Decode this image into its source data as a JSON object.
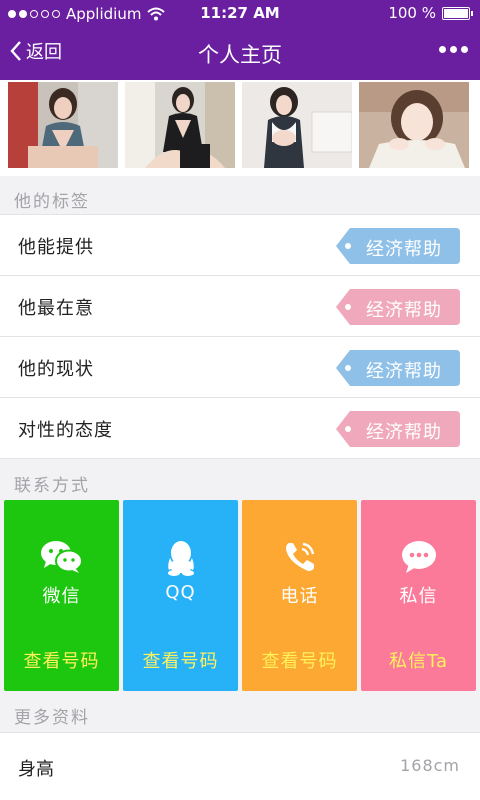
{
  "status_bar": {
    "carrier": "Applidium",
    "time": "11:27 AM",
    "battery": "100 %"
  },
  "nav": {
    "back_label": "返回",
    "title": "个人主页"
  },
  "tags_section": {
    "title": "他的标签",
    "rows": [
      {
        "label": "他能提供",
        "tag": "经济帮助",
        "tag_color": "#8fc0e8"
      },
      {
        "label": "他最在意",
        "tag": "经济帮助",
        "tag_color": "#f0a9bc"
      },
      {
        "label": "他的现状",
        "tag": "经济帮助",
        "tag_color": "#8fc0e8"
      },
      {
        "label": "对性的态度",
        "tag": "经济帮助",
        "tag_color": "#f0a9bc"
      }
    ]
  },
  "contact_section": {
    "title": "联系方式",
    "cards": [
      {
        "name": "微信",
        "action": "查看号码",
        "color": "#1ec70f",
        "icon": "wechat-icon"
      },
      {
        "name": "QQ",
        "action": "查看号码",
        "color": "#27b1f6",
        "icon": "qq-icon"
      },
      {
        "name": "电话",
        "action": "查看号码",
        "color": "#fca832",
        "icon": "phone-icon"
      },
      {
        "name": "私信",
        "action": "私信Ta",
        "color": "#fb7a99",
        "icon": "message-icon"
      }
    ]
  },
  "more_section": {
    "title": "更多资料",
    "rows": [
      {
        "label": "身高",
        "value": "168cm"
      }
    ]
  }
}
